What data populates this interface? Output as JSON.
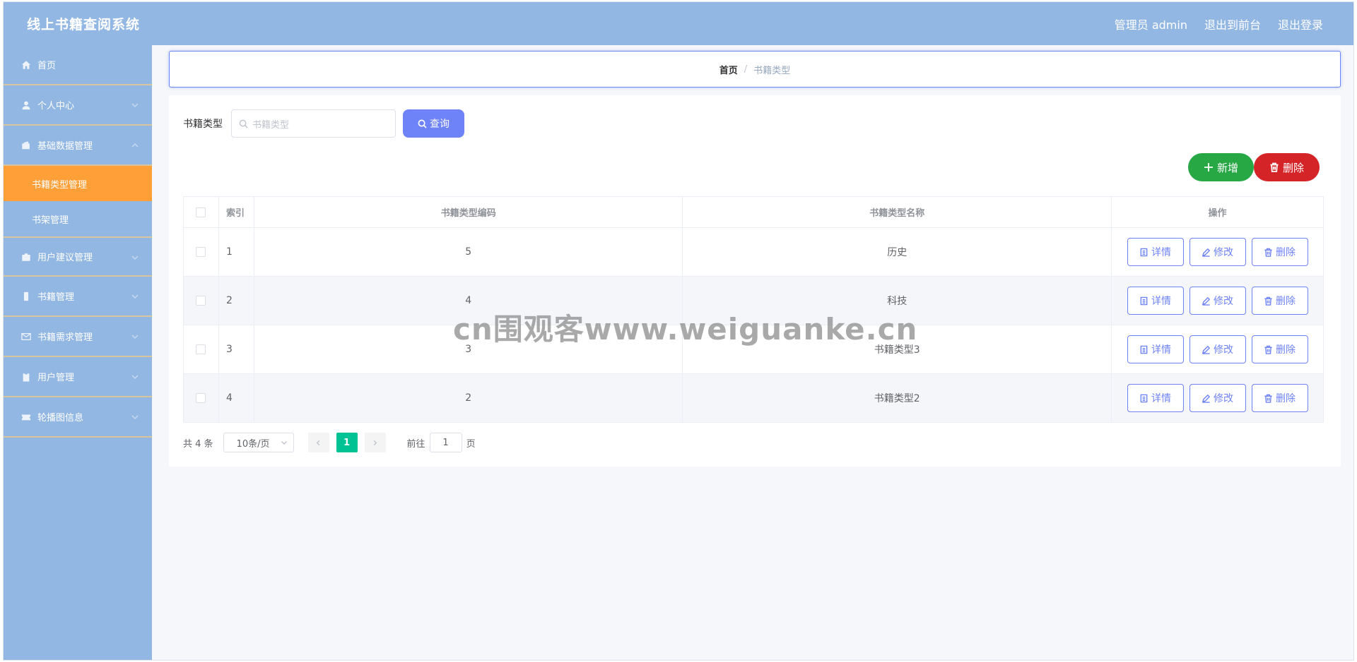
{
  "header": {
    "brand": "线上书籍查阅系统",
    "admin_label": "管理员 admin",
    "exit_front": "退出到前台",
    "logout": "退出登录"
  },
  "sidebar": {
    "items": [
      {
        "label": "首页",
        "icon": "home-icon",
        "expandable": false
      },
      {
        "label": "个人中心",
        "icon": "user-icon",
        "expandable": true
      },
      {
        "label": "基础数据管理",
        "icon": "wallet-icon",
        "expandable": true,
        "expanded": true,
        "children": [
          {
            "label": "书籍类型管理",
            "active": true
          },
          {
            "label": "书架管理",
            "active": false
          }
        ]
      },
      {
        "label": "用户建议管理",
        "icon": "briefcase-icon",
        "expandable": true
      },
      {
        "label": "书籍管理",
        "icon": "phone-icon",
        "expandable": true
      },
      {
        "label": "书籍需求管理",
        "icon": "mail-icon",
        "expandable": true
      },
      {
        "label": "用户管理",
        "icon": "clipboard-icon",
        "expandable": true
      },
      {
        "label": "轮播图信息",
        "icon": "ticket-icon",
        "expandable": true
      }
    ]
  },
  "breadcrumb": {
    "home": "首页",
    "separator": "/",
    "current": "书籍类型"
  },
  "search": {
    "label": "书籍类型",
    "placeholder": "书籍类型",
    "button": "查询"
  },
  "actions": {
    "add": "新增",
    "delete": "删除"
  },
  "table": {
    "headers": [
      "索引",
      "书籍类型编码",
      "书籍类型名称",
      "操作"
    ],
    "rows": [
      {
        "index": "1",
        "code": "5",
        "name": "历史"
      },
      {
        "index": "2",
        "code": "4",
        "name": "科技"
      },
      {
        "index": "3",
        "code": "3",
        "name": "书籍类型3"
      },
      {
        "index": "4",
        "code": "2",
        "name": "书籍类型2"
      }
    ],
    "row_actions": {
      "detail": "详情",
      "edit": "修改",
      "delete": "删除"
    }
  },
  "pagination": {
    "total": "共 4 条",
    "page_size": "10条/页",
    "current_page": "1",
    "goto_prefix": "前往",
    "goto_value": "1",
    "goto_suffix": "页"
  },
  "watermark": "cn围观客www.weiguanke.cn",
  "colors": {
    "header_bg": "#93b7e3",
    "active_menu": "#ff9f38",
    "primary": "#6e83f7",
    "success": "#28a745",
    "danger": "#d42427",
    "pager_active": "#00c292"
  }
}
